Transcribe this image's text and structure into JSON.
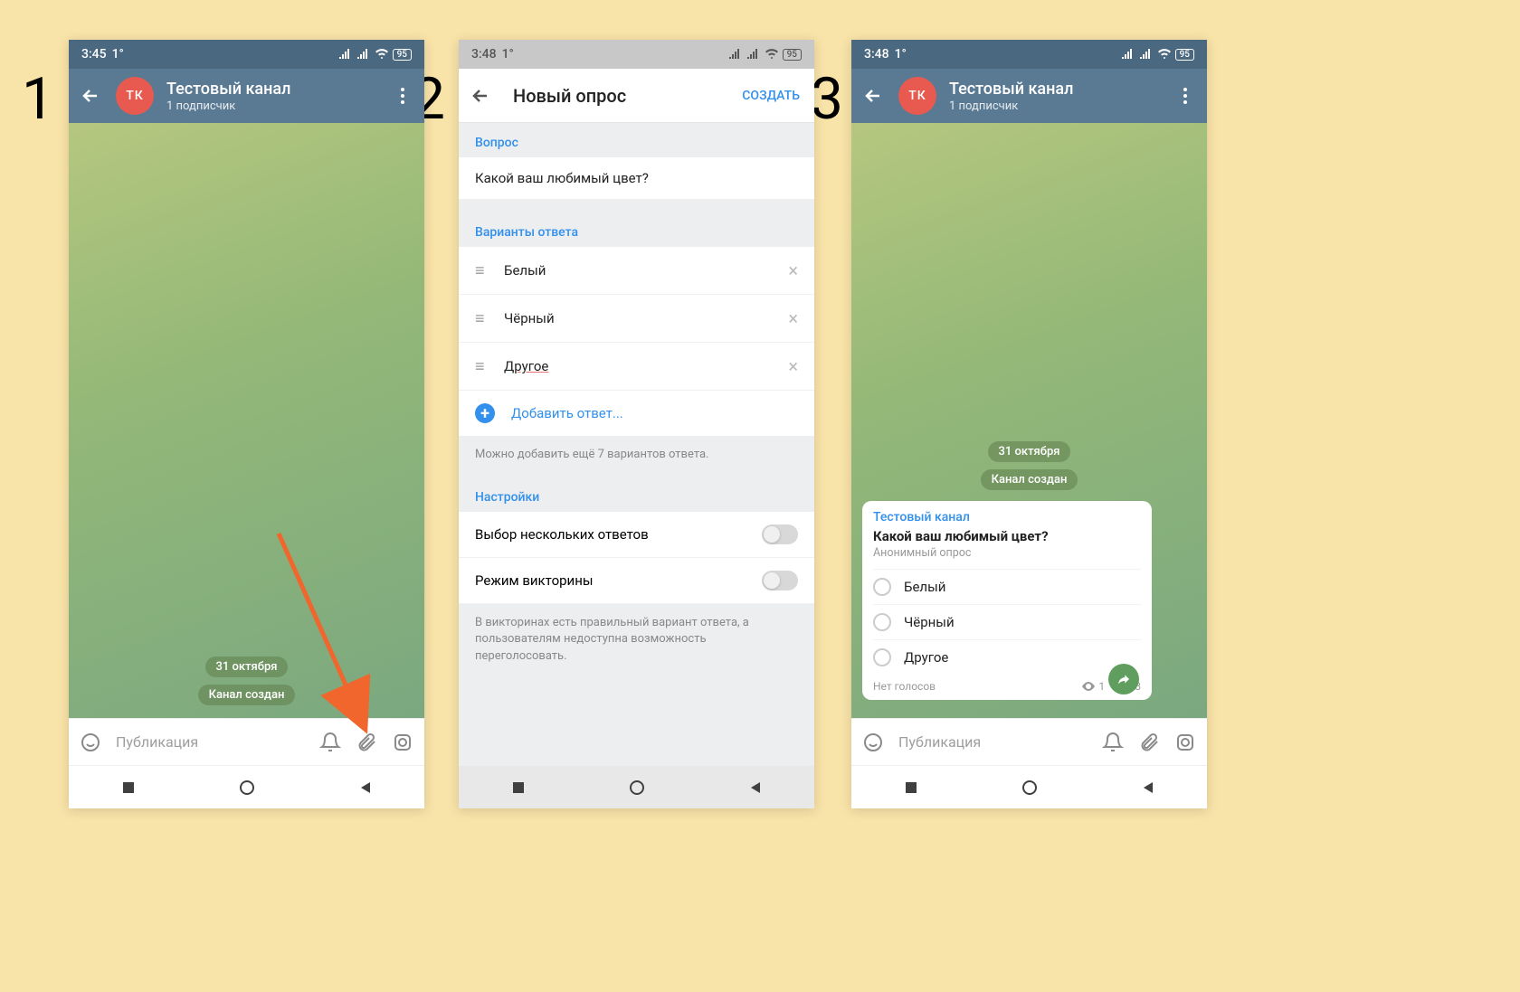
{
  "labels": {
    "step1": "1",
    "step2": "2",
    "step3": "3"
  },
  "status": {
    "time1": "3:45",
    "time2": "3:48",
    "time3": "3:48",
    "notif": "1°",
    "battery": "95"
  },
  "channel": {
    "avatar_initials": "ТК",
    "title": "Тестовый канал",
    "subscribers": "1 подписчик"
  },
  "chat": {
    "date_chip": "31 октября",
    "service_msg": "Канал создан",
    "input_placeholder": "Публикация"
  },
  "poll_create": {
    "header_title": "Новый опрос",
    "create_btn": "СОЗДАТЬ",
    "section_question": "Вопрос",
    "question_text": "Какой ваш любимый цвет?",
    "section_options": "Варианты ответа",
    "options": [
      "Белый",
      "Чёрный",
      "Другое"
    ],
    "add_option": "Добавить ответ...",
    "options_hint": "Можно добавить ещё 7 вариантов ответа.",
    "section_settings": "Настройки",
    "multi_answer": "Выбор нескольких ответов",
    "quiz_mode": "Режим викторины",
    "quiz_hint": "В викторинах есть правильный вариант ответа, а пользователям недоступна возможность переголосовать."
  },
  "poll_msg": {
    "sender": "Тестовый канал",
    "question": "Какой ваш любимый цвет?",
    "type_label": "Анонимный опрос",
    "options": [
      "Белый",
      "Чёрный",
      "Другое"
    ],
    "votes_label": "Нет голосов",
    "views": "1",
    "time": "03:48"
  }
}
